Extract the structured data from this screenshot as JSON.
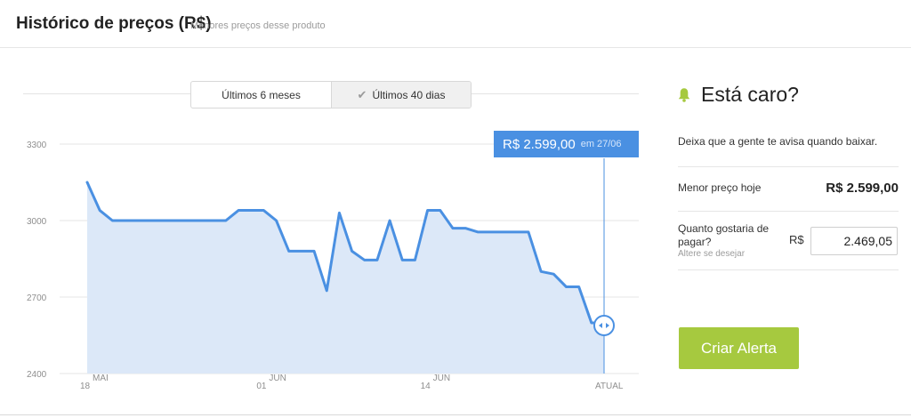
{
  "header": {
    "title": "Histórico de preços (R$)",
    "subtitle": "Menores preços desse produto"
  },
  "period_toggle": {
    "options": [
      "Últimos 6 meses",
      "Últimos 40 dias"
    ],
    "selected": "Últimos 40 dias",
    "check_icon": "check-icon"
  },
  "tooltip": {
    "price": "R$ 2.599,00",
    "em": "em",
    "date": "27/06"
  },
  "alert": {
    "title": "Está caro?",
    "bell_icon": "bell-icon",
    "bell_color": "#a6c93f",
    "description": "Deixa que a gente te avisa quando baixar.",
    "lowest_label": "Menor preço hoje",
    "lowest_value": "R$ 2.599,00",
    "want_label": "Quanto gostaria de pagar?",
    "hint": "Altere se desejar",
    "currency": "R$",
    "input_value": "2.469,05",
    "button_label": "Criar Alerta",
    "button_color": "#a6c93f"
  },
  "chart_data": {
    "type": "area",
    "y_ticks": [
      "3300",
      "3000",
      "2700",
      "2400"
    ],
    "ylim": [
      2400,
      3300
    ],
    "x_tick_labels": [
      {
        "day": "18",
        "month": "MAI"
      },
      {
        "day": "01",
        "month": "JUN"
      },
      {
        "day": "14",
        "month": "JUN"
      },
      {
        "day": "",
        "month": "ATUAL"
      }
    ],
    "x_tick_index": [
      0,
      14,
      27,
      41
    ],
    "values": [
      3150,
      3040,
      3000,
      3000,
      3000,
      3000,
      3000,
      3000,
      3000,
      3000,
      3000,
      3000,
      3040,
      3040,
      3040,
      3000,
      2880,
      2880,
      2880,
      2725,
      3030,
      2880,
      2845,
      2845,
      3000,
      2845,
      2845,
      3040,
      3040,
      2970,
      2970,
      2955,
      2955,
      2955,
      2955,
      2955,
      2800,
      2790,
      2740,
      2740,
      2599,
      2599
    ],
    "line_color": "#4a90e2",
    "fill_color": "#dce8f8",
    "grid": true
  }
}
